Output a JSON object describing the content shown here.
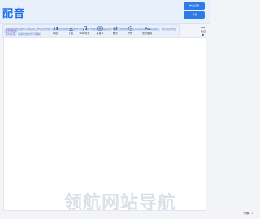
{
  "header": {
    "logo": "配音",
    "buttons": [
      {
        "label": "作品记录",
        "icon": "history-icon"
      },
      {
        "label": "+下载",
        "icon": "download-icon"
      }
    ]
  },
  "notice": {
    "text": "本网站由学霸魔象可通应用工作语音合成与交互的合成技术提供技术支持，用户所使用的内容请遵守相关法律法规，有任何问题请随时联系我们，我们将及时回复并处理，感谢您的支持与理解！"
  },
  "toolbar": {
    "role_prefix": "当前角色：",
    "role_value": "--",
    "tools": [
      {
        "label": "停顿",
        "icon": "pause-icon"
      },
      {
        "label": "下载",
        "icon": "download-icon"
      },
      {
        "label": "BGM背景",
        "icon": "music-icon"
      },
      {
        "label": "多音字",
        "icon": "pinyin-icon"
      },
      {
        "label": "数字",
        "icon": "number-icon"
      },
      {
        "label": "符号",
        "icon": "symbol-icon"
      },
      {
        "label": "文字编辑",
        "icon": "text-edit-icon"
      }
    ],
    "side_tools": [
      {
        "label": "清空",
        "icon": "clear-icon"
      },
      {
        "label": "试听",
        "icon": "play-icon"
      }
    ]
  },
  "editor": {
    "content": ""
  },
  "footer": {
    "word_count_label": "字数：0"
  },
  "watermark": "领航网站导航"
}
